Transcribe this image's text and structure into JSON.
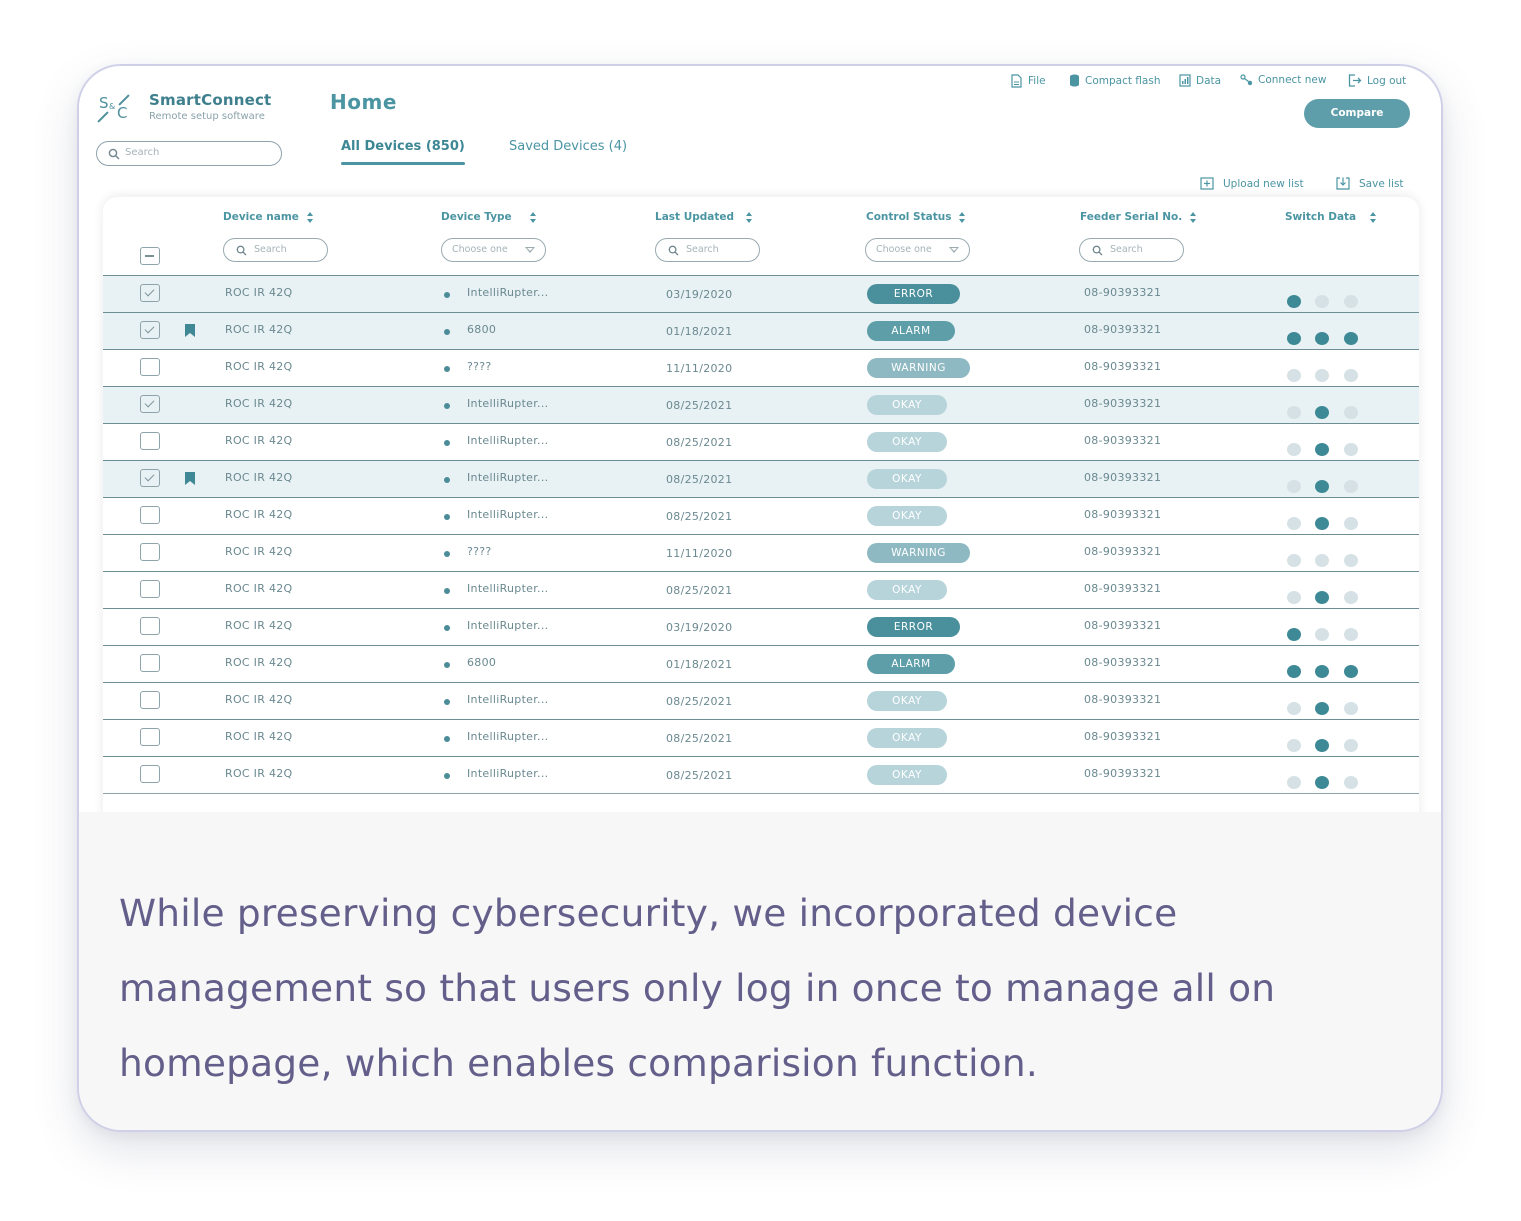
{
  "brand": {
    "name": "SmartConnect",
    "subtitle": "Remote setup software",
    "logo_text": {
      "s": "S",
      "amp": "&",
      "c": "C"
    }
  },
  "page_title": "Home",
  "search": {
    "placeholder": "Search"
  },
  "tabs": [
    {
      "label": "All Devices (850)",
      "active": true
    },
    {
      "label": "Saved Devices (4)",
      "active": false
    }
  ],
  "topnav": [
    {
      "label": "File",
      "icon": "file-icon"
    },
    {
      "label": "Compact flash",
      "icon": "database-icon"
    },
    {
      "label": "Data",
      "icon": "chart-icon"
    },
    {
      "label": "Connect new",
      "icon": "link-icon"
    },
    {
      "label": "Log out",
      "icon": "logout-icon"
    }
  ],
  "compare_label": "Compare",
  "list_actions": {
    "upload": "Upload new list",
    "save": "Save list"
  },
  "columns": {
    "device_name": "Device name",
    "device_type": "Device Type",
    "last_updated": "Last Updated",
    "control_status": "Control Status",
    "feeder_serial": "Feeder Serial No.",
    "switch_data": "Switch Data"
  },
  "filters": {
    "search_placeholder": "Search",
    "select_placeholder": "Choose one"
  },
  "status_colors": {
    "ERROR": "#4a909c",
    "ALARM": "#5e9ea9",
    "WARNING": "#8fb9c2",
    "OKAY": "#b6d4da"
  },
  "rows": [
    {
      "checked": true,
      "saved": false,
      "name": "ROC IR 42Q",
      "type": "IntelliRupter...",
      "date": "03/19/2020",
      "status": "ERROR",
      "serial": "08-90393321",
      "switch": [
        1,
        0,
        0
      ]
    },
    {
      "checked": true,
      "saved": true,
      "name": "ROC IR 42Q",
      "type": "6800",
      "date": "01/18/2021",
      "status": "ALARM",
      "serial": "08-90393321",
      "switch": [
        1,
        1,
        1
      ]
    },
    {
      "checked": false,
      "saved": false,
      "name": "ROC IR 42Q",
      "type": "????",
      "date": "11/11/2020",
      "status": "WARNING",
      "serial": "08-90393321",
      "switch": [
        0,
        0,
        0
      ]
    },
    {
      "checked": true,
      "saved": false,
      "name": "ROC IR 42Q",
      "type": "IntelliRupter...",
      "date": "08/25/2021",
      "status": "OKAY",
      "serial": "08-90393321",
      "switch": [
        0,
        1,
        0
      ]
    },
    {
      "checked": false,
      "saved": false,
      "name": "ROC IR 42Q",
      "type": "IntelliRupter...",
      "date": "08/25/2021",
      "status": "OKAY",
      "serial": "08-90393321",
      "switch": [
        0,
        1,
        0
      ]
    },
    {
      "checked": true,
      "saved": true,
      "name": "ROC IR 42Q",
      "type": "IntelliRupter...",
      "date": "08/25/2021",
      "status": "OKAY",
      "serial": "08-90393321",
      "switch": [
        0,
        1,
        0
      ]
    },
    {
      "checked": false,
      "saved": false,
      "name": "ROC IR 42Q",
      "type": "IntelliRupter...",
      "date": "08/25/2021",
      "status": "OKAY",
      "serial": "08-90393321",
      "switch": [
        0,
        1,
        0
      ]
    },
    {
      "checked": false,
      "saved": false,
      "name": "ROC IR 42Q",
      "type": "????",
      "date": "11/11/2020",
      "status": "WARNING",
      "serial": "08-90393321",
      "switch": [
        0,
        0,
        0
      ]
    },
    {
      "checked": false,
      "saved": false,
      "name": "ROC IR 42Q",
      "type": "IntelliRupter...",
      "date": "08/25/2021",
      "status": "OKAY",
      "serial": "08-90393321",
      "switch": [
        0,
        1,
        0
      ]
    },
    {
      "checked": false,
      "saved": false,
      "name": "ROC IR 42Q",
      "type": "IntelliRupter...",
      "date": "03/19/2020",
      "status": "ERROR",
      "serial": "08-90393321",
      "switch": [
        1,
        0,
        0
      ]
    },
    {
      "checked": false,
      "saved": false,
      "name": "ROC IR 42Q",
      "type": "6800",
      "date": "01/18/2021",
      "status": "ALARM",
      "serial": "08-90393321",
      "switch": [
        1,
        1,
        1
      ]
    },
    {
      "checked": false,
      "saved": false,
      "name": "ROC IR 42Q",
      "type": "IntelliRupter...",
      "date": "08/25/2021",
      "status": "OKAY",
      "serial": "08-90393321",
      "switch": [
        0,
        1,
        0
      ]
    },
    {
      "checked": false,
      "saved": false,
      "name": "ROC IR 42Q",
      "type": "IntelliRupter...",
      "date": "08/25/2021",
      "status": "OKAY",
      "serial": "08-90393321",
      "switch": [
        0,
        1,
        0
      ]
    },
    {
      "checked": false,
      "saved": false,
      "name": "ROC IR 42Q",
      "type": "IntelliRupter...",
      "date": "08/25/2021",
      "status": "OKAY",
      "serial": "08-90393321",
      "switch": [
        0,
        1,
        0
      ]
    }
  ],
  "caption": "While preserving cybersecurity, we incorporated device management so that users only log in once to manage all on homepage, which enables comparision function."
}
